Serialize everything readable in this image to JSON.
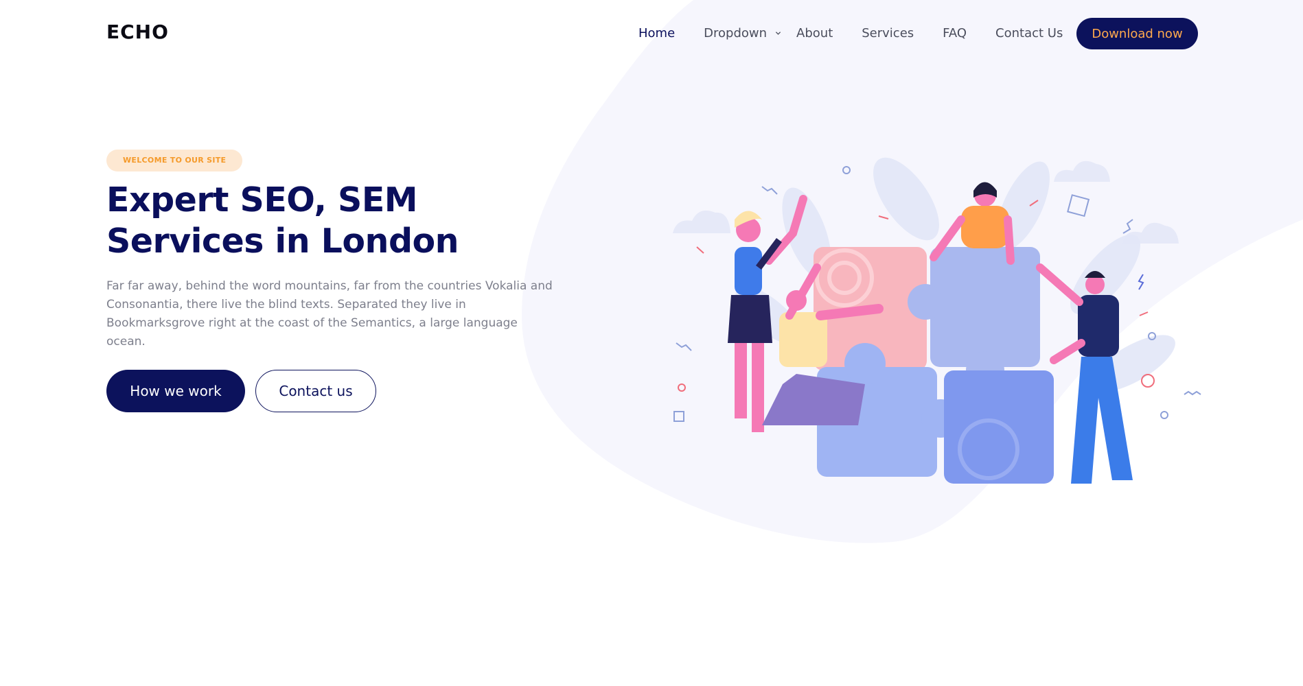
{
  "brand": {
    "logo_text": "ECHO"
  },
  "nav": {
    "items": [
      {
        "label": "Home",
        "active": true
      },
      {
        "label": "Dropdown",
        "has_dropdown": true
      },
      {
        "label": "About"
      },
      {
        "label": "Services"
      },
      {
        "label": "FAQ"
      },
      {
        "label": "Contact Us"
      }
    ],
    "cta_label": "Download now"
  },
  "hero": {
    "badge": "WELCOME TO OUR SITE",
    "title_line1": "Expert SEO, SEM",
    "title_line2": "Services in London",
    "description": "Far far away, behind the word mountains, far from the countries Vokalia and Consonantia, there live the blind texts. Separated they live in Bookmarksgrove right at the coast of the Semantics, a large language ocean.",
    "primary_button": "How we work",
    "secondary_button": "Contact us"
  },
  "colors": {
    "navy": "#0c125c",
    "accent_orange": "#ffa94d",
    "badge_bg": "#fde8d2",
    "badge_text": "#f59a2a",
    "blob": "#f6f6fd"
  },
  "icons": {
    "dropdown": "chevron-down-icon"
  }
}
